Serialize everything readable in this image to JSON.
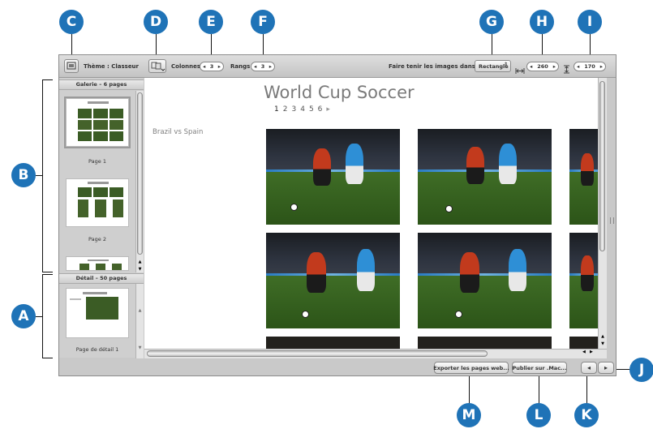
{
  "callouts": {
    "a": "A",
    "b": "B",
    "c": "C",
    "d": "D",
    "e": "E",
    "f": "F",
    "g": "G",
    "h": "H",
    "i": "I",
    "j": "J",
    "k": "K",
    "l": "L",
    "m": "M"
  },
  "toolbar": {
    "theme_label": "Thème : Classeur",
    "columns_label": "Colonnes :",
    "columns_value": "3",
    "rows_label": "Rangs :",
    "rows_value": "3",
    "fit_label": "Faire tenir les images dans :",
    "fit_value": "Rectangle",
    "width_value": "260",
    "height_value": "170",
    "stepper_left": "◂",
    "stepper_right": "▸"
  },
  "sidebar": {
    "gallery_header": "Galerie – 6 pages",
    "gallery_pages": [
      "Page 1",
      "Page 2"
    ],
    "detail_header": "Détail – 50 pages",
    "detail_pages": [
      "Page de détail 1"
    ]
  },
  "content": {
    "title": "World Cup Soccer",
    "pages": [
      "1",
      "2",
      "3",
      "4",
      "5",
      "6"
    ],
    "next_arrow": "▸",
    "album_caption": "Brazil vs Spain"
  },
  "bottom": {
    "export_label": "Exporter les pages web...",
    "publish_label": "Publier sur .Mac...",
    "prev_label": "◂",
    "next_label": "▸"
  },
  "colors": {
    "accent": "#1f73b7"
  }
}
